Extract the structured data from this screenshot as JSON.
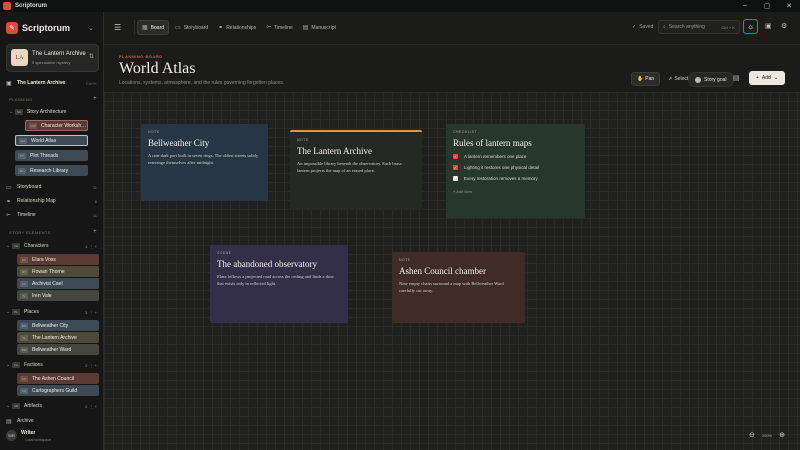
{
  "app": {
    "title": "Scriptorum",
    "window_controls": [
      "–",
      "▢",
      "✕"
    ]
  },
  "sidebar": {
    "brand": "Scriptorum",
    "project": {
      "initials": "LA",
      "title": "The Lantern Archive",
      "subtitle": "5 speculative mystery"
    },
    "current": {
      "label": "The Lantern Archive",
      "shortcut": "Ctrl+K"
    },
    "planning_header": "PLANNING",
    "story_arch": {
      "badge": "SA",
      "label": "Story Architecture"
    },
    "tree_items": [
      {
        "badge": "CW",
        "label": "Character Worksh…",
        "color": "#5a3a32"
      },
      {
        "badge": "WA",
        "label": "World Atlas",
        "color": "#3d4a56"
      },
      {
        "badge": "PT",
        "label": "Plot Threads",
        "color": "#3d4a56"
      },
      {
        "badge": "RL",
        "label": "Research Library",
        "color": "#3d4a56"
      }
    ],
    "nav": [
      {
        "label": "Storyboard",
        "count": "11"
      },
      {
        "label": "Relationship Map",
        "count": "8"
      },
      {
        "label": "Timeline",
        "count": "11"
      }
    ],
    "story_elements_header": "STORY ELEMENTS",
    "groups": [
      {
        "badge": "CH",
        "label": "Characters",
        "count": "4",
        "items": [
          {
            "badge": "EV",
            "label": "Elara Voss",
            "color": "#5a3a32"
          },
          {
            "badge": "RT",
            "label": "Rowan Thorne",
            "color": "#4e4a3a"
          },
          {
            "badge": "AC",
            "label": "Archivist Cael",
            "color": "#3d4a56"
          },
          {
            "badge": "IV",
            "label": "Iren Vale",
            "color": "#44463f"
          }
        ]
      },
      {
        "badge": "PL",
        "label": "Places",
        "count": "3",
        "items": [
          {
            "badge": "BC",
            "label": "Bellweather City",
            "color": "#3d4a56"
          },
          {
            "badge": "TL",
            "label": "The Lantern Archive",
            "color": "#4e4a3a"
          },
          {
            "badge": "BW",
            "label": "Bellweather Ward",
            "color": "#44463f"
          }
        ]
      },
      {
        "badge": "FA",
        "label": "Factions",
        "count": "2",
        "items": [
          {
            "badge": "AC",
            "label": "The Ashen Council",
            "color": "#5a3a32"
          },
          {
            "badge": "CG",
            "label": "Cartographers Guild",
            "color": "#3d4a56"
          }
        ]
      },
      {
        "badge": "AR",
        "label": "Artifacts",
        "count": "2",
        "items": []
      }
    ],
    "archive": "Archive",
    "user": {
      "initials": "WR",
      "name": "Writer",
      "role": "Local workspace"
    }
  },
  "toolbar": {
    "tabs": [
      {
        "icon": "▦",
        "label": "Board",
        "active": true
      },
      {
        "icon": "▭",
        "label": "Storyboard"
      },
      {
        "icon": "⚭",
        "label": "Relationships"
      },
      {
        "icon": "⟜",
        "label": "Timeline"
      },
      {
        "icon": "▤",
        "label": "Manuscript"
      }
    ],
    "saved": "Saved",
    "search_placeholder": "Search anything",
    "search_shortcut": "Ctrl + K"
  },
  "header": {
    "kicker": "PLANNING BOARD",
    "title": "World Atlas",
    "subtitle": "Locations, systems, atmosphere, and the rules governing forgotten places."
  },
  "modes": {
    "pan": "Pan",
    "select": "Select",
    "goal": "Story goal",
    "add": "Add"
  },
  "cards": [
    {
      "type": "NOTE",
      "title": "Bellweather City",
      "body": "A rain-dark port built in seven rings. The oldest streets subtly rearrange themselves after midnight.",
      "bg": "#263645",
      "accent": ""
    },
    {
      "type": "NOTE",
      "title": "The Lantern Archive",
      "body": "An impossible library beneath the observatory. Each brass lantern projects the map of an erased place.",
      "bg": "#262824",
      "accent": "#d99a4a"
    },
    {
      "type": "CHECKLIST",
      "title": "Rules of lantern maps",
      "bg": "#27372c",
      "checks": [
        {
          "label": "A lantern remembers one place",
          "done": true
        },
        {
          "label": "Lighting it restores one physical detail",
          "done": true
        },
        {
          "label": "Every restoration removes a memory",
          "done": false
        }
      ],
      "add_label": "+ Add item"
    },
    {
      "type": "SCENE",
      "title": "The abandoned observatory",
      "body": "Elara follows a projected road across the ceiling and finds a door that exists only in reflected light.",
      "bg": "#332f49",
      "accent": ""
    },
    {
      "type": "NOTE",
      "title": "Ashen Council chamber",
      "body": "Nine empty chairs surround a map with Bellweather Ward carefully cut away.",
      "bg": "#3f2c26",
      "accent": ""
    }
  ],
  "zoom": {
    "out": "⊖",
    "level": "100%",
    "in": "⊕"
  }
}
